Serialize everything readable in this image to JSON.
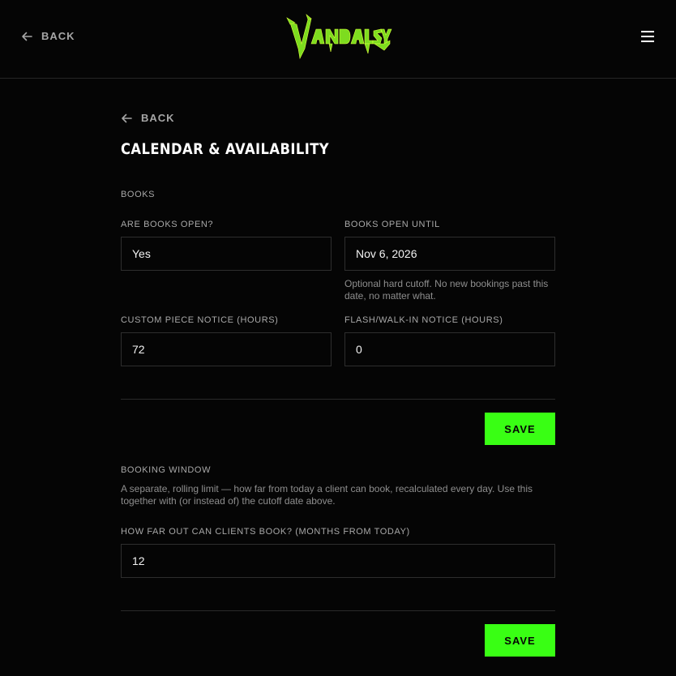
{
  "header": {
    "back_label": "BACK",
    "logo_text": "VANDALSYN",
    "menu_icon": "hamburger-menu-icon"
  },
  "page": {
    "back_label": "BACK",
    "title": "CALENDAR & AVAILABILITY"
  },
  "books": {
    "section_label": "BOOKS",
    "are_books_open": {
      "label": "ARE BOOKS OPEN?",
      "value": "Yes"
    },
    "books_open_until": {
      "label": "BOOKS OPEN UNTIL",
      "value": "Nov 6, 2026",
      "helper": "Optional hard cutoff. No new bookings past this date, no matter what."
    },
    "custom_notice": {
      "label": "CUSTOM PIECE NOTICE (HOURS)",
      "value": "72"
    },
    "flash_notice": {
      "label": "FLASH/WALK-IN NOTICE (HOURS)",
      "value": "0"
    },
    "save_label": "SAVE"
  },
  "booking_window": {
    "section_label": "BOOKING WINDOW",
    "description": "A separate, rolling limit — how far from today a client can book, recalculated every day. Use this together with (or instead of) the cutoff date above.",
    "months": {
      "label": "HOW FAR OUT CAN CLIENTS BOOK? (MONTHS FROM TODAY)",
      "value": "12"
    },
    "save_label": "SAVE"
  },
  "colors": {
    "accent": "#39ff14",
    "background": "#050505",
    "border": "#2e2e2e",
    "muted_text": "#a8a8a8"
  }
}
